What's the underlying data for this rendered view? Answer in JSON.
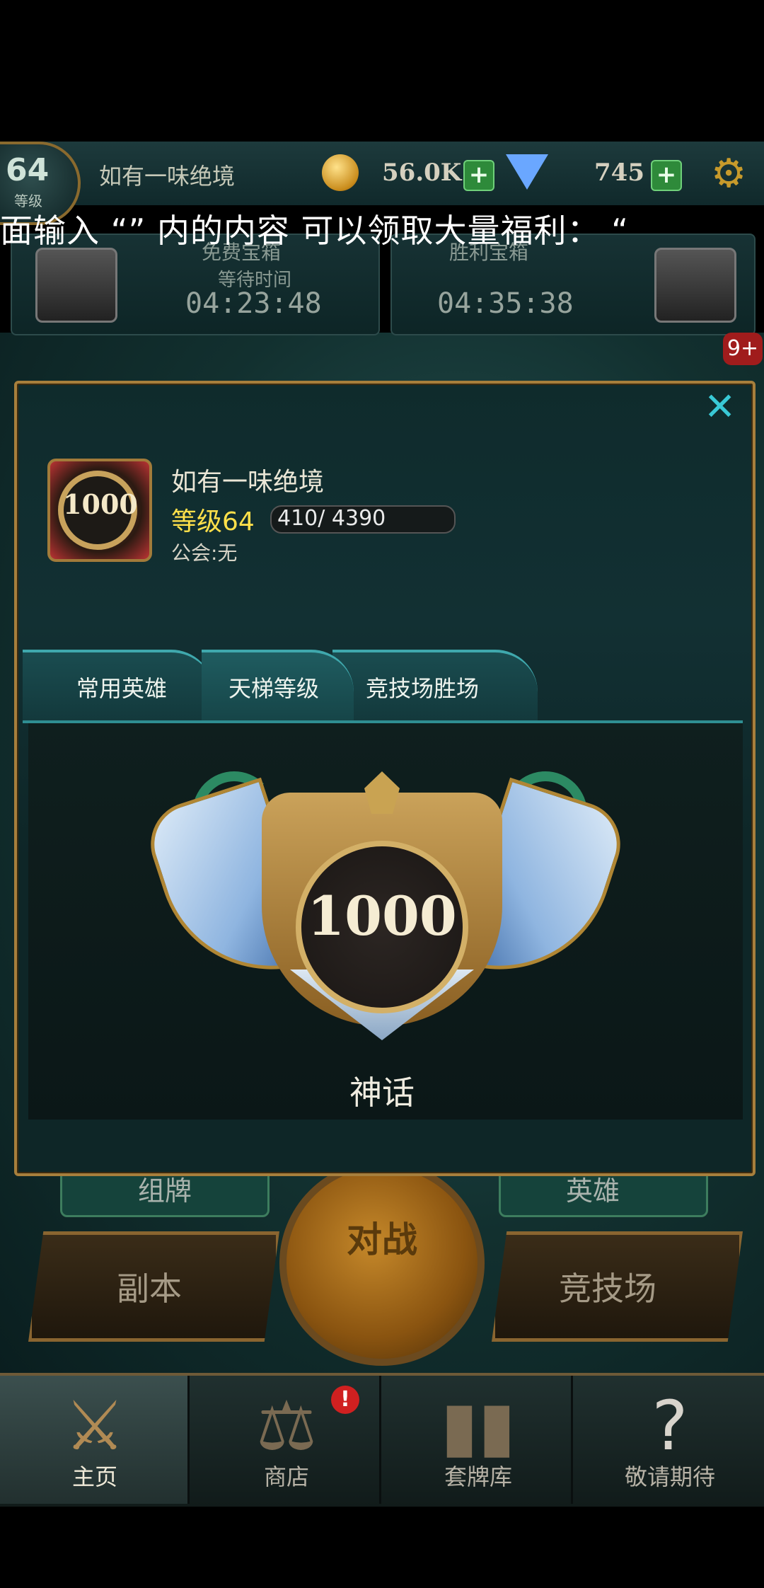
{
  "top_bar": {
    "level_number": "64",
    "level_label": "等级",
    "player_name": "如有一味绝境",
    "gold": "56.0K",
    "gems": "745",
    "plus": "+"
  },
  "banner_text": "面输入 “” 内的内容 可以领取大量福利： “",
  "chests": {
    "free_label": "免费宝箱",
    "wait_label": "等待时间",
    "free_timer": "04:23:48",
    "win_label": "胜利宝箱",
    "win_timer": "04:35:38",
    "badge": "9+"
  },
  "modal": {
    "close": "✕",
    "avatar_rating": "1000",
    "name": "如有一味绝境",
    "level": "等级64",
    "xp": "410/ 4390",
    "xp_fraction": 0.093,
    "guild": "公会:无",
    "tabs": [
      "常用英雄",
      "天梯等级",
      "竞技场胜场"
    ],
    "active_tab": 1,
    "rank_score": "1000",
    "rank_name": "神话"
  },
  "actions": {
    "deck": "组牌",
    "hero": "英雄",
    "battle": "对战",
    "dungeon": "副本",
    "arena": "竞技场"
  },
  "nav": {
    "home": "主页",
    "shop": "商店",
    "decks": "套牌库",
    "soon": "敬请期待",
    "shop_alert": "!"
  }
}
